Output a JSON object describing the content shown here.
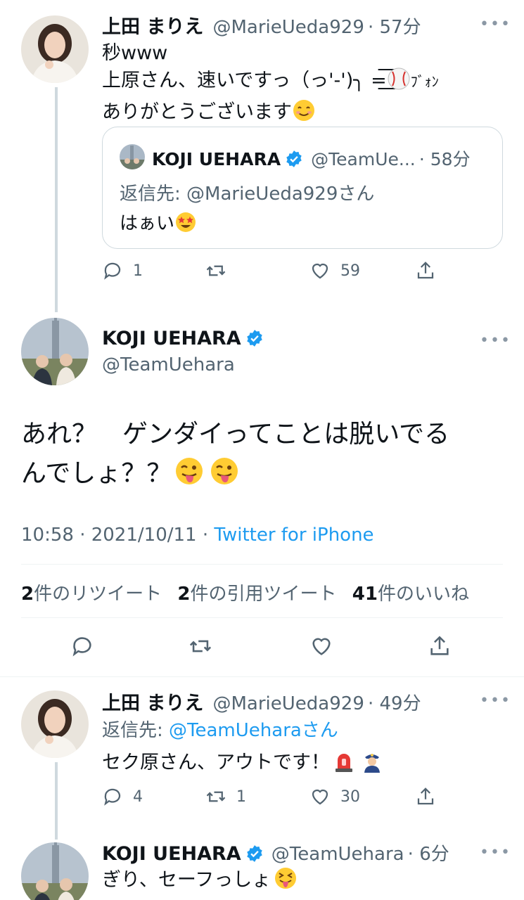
{
  "tweet1": {
    "name": "上田 まりえ",
    "handle": "@MarieUeda929",
    "time": "· 57分",
    "line1": "秒www",
    "line2": "上原さん、速いですっ（っ'-')╮ =͟͟͞͞",
    "line2_tail": "ﾌﾞｫﾝ",
    "line3": "ありがとうございます",
    "quote": {
      "name": "KOJI UEHARA",
      "handle": "@TeamUe...",
      "time": "· 58分",
      "reply_label": "返信先:",
      "reply_handle": "@MarieUeda929さん",
      "text": "はぁい"
    },
    "stats": {
      "replies": "1",
      "retweets": "",
      "likes": "59"
    }
  },
  "main_tweet": {
    "name": "KOJI UEHARA",
    "handle": "@TeamUehara",
    "line1": "あれ？　ゲンダイってことは脱いでる",
    "line2": "んでしょ？？",
    "timestamp": "10:58 · 2021/10/11 ·",
    "source": "Twitter for iPhone",
    "retweet_count": "2",
    "retweet_label": "件のリツイート",
    "quote_count": "2",
    "quote_label": "件の引用ツイート",
    "like_count": "41",
    "like_label": "件のいいね"
  },
  "reply1": {
    "name": "上田 まりえ",
    "handle": "@MarieUeda929",
    "time": "· 49分",
    "reply_label": "返信先:",
    "reply_handle": "@TeamUeharaさん",
    "text": "セク原さん、アウトです！",
    "stats": {
      "replies": "4",
      "retweets": "1",
      "likes": "30"
    }
  },
  "reply2": {
    "name": "KOJI UEHARA",
    "handle": "@TeamUehara",
    "time": "· 6分",
    "text": "ぎり、セーフっしょ"
  },
  "colors": {
    "accent": "#1d9bf0",
    "secondary_text": "#536471",
    "thread_line": "#cfd9de"
  }
}
